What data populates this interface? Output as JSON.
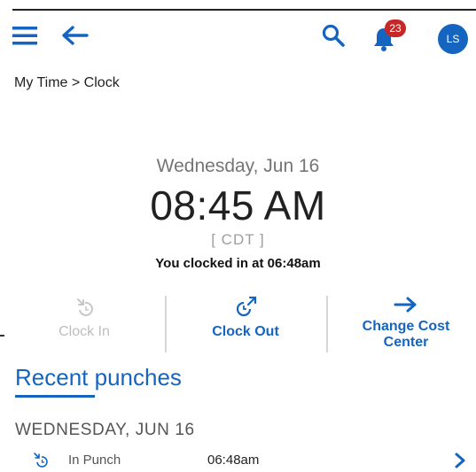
{
  "header": {
    "notification_count": "23",
    "avatar_initials": "LS",
    "accent_color": "#1565c0",
    "badge_color": "#c62828"
  },
  "breadcrumb": "My Time > Clock",
  "clock": {
    "date": "Wednesday, Jun 16",
    "time": "08:45 AM",
    "timezone": "[ CDT ]",
    "status": "You clocked in at 06:48am"
  },
  "actions": {
    "clock_in": "Clock In",
    "clock_out": "Clock Out",
    "change_cost_line1": "Change Cost",
    "change_cost_line2": "Center"
  },
  "recent": {
    "title": "Recent punches",
    "day_header": "WEDNESDAY, JUN 16",
    "punches": [
      {
        "type": "In Punch",
        "time": "06:48am",
        "icon": "clock-in-icon"
      }
    ]
  }
}
